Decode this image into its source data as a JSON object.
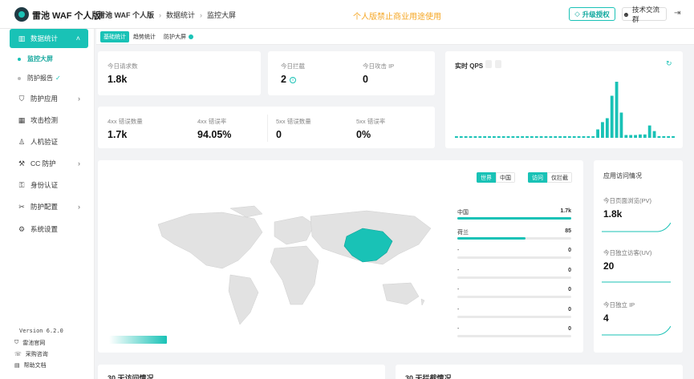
{
  "app": {
    "title": "雷池 WAF 个人版"
  },
  "breadcrumb": {
    "root": "雷池 WAF 个人版",
    "level1": "数据统计",
    "level2": "监控大屏"
  },
  "notice": "个人版禁止商业用途使用",
  "header": {
    "upgrade_label": "升级授权",
    "chat_label": "技术交流群",
    "logout_icon": "logout-icon"
  },
  "sidebar": {
    "items": [
      {
        "label": "数据统计",
        "icon": "chart-icon"
      },
      {
        "label": "防护应用",
        "icon": "shield-icon"
      },
      {
        "label": "攻击检测",
        "icon": "calendar-icon"
      },
      {
        "label": "人机验证",
        "icon": "user-icon"
      },
      {
        "label": "CC 防护",
        "icon": "wrench-icon"
      },
      {
        "label": "身份认证",
        "icon": "id-icon"
      },
      {
        "label": "防护配置",
        "icon": "tools-icon"
      },
      {
        "label": "系统设置",
        "icon": "gear-icon"
      }
    ],
    "sub_items": [
      {
        "label": "监控大屏"
      },
      {
        "label": "防护报告"
      }
    ],
    "version": "Version 6.2.0",
    "footer_links": [
      {
        "label": "雷池官网"
      },
      {
        "label": "采购咨询"
      },
      {
        "label": "帮助文档"
      }
    ]
  },
  "tabs": [
    {
      "label": "基础统计"
    },
    {
      "label": "趋势统计"
    },
    {
      "label": "防护大屏"
    }
  ],
  "stats_top": [
    {
      "label": "今日请求数",
      "value": "1.8k"
    },
    {
      "label": "今日拦截",
      "value": "2"
    },
    {
      "label": "今日攻击 IP",
      "value": "0"
    }
  ],
  "stats_errors": [
    {
      "label": "4xx 错误数量",
      "value": "1.7k"
    },
    {
      "label": "4xx 错误率",
      "value": "94.05%"
    },
    {
      "label": "5xx 错误数量",
      "value": "0"
    },
    {
      "label": "5xx 错误率",
      "value": "0%"
    }
  ],
  "qps": {
    "title": "实时 QPS",
    "bar_levels": [
      0.02,
      0.02,
      0.02,
      0.02,
      0.02,
      0.02,
      0.02,
      0.02,
      0.02,
      0.02,
      0.02,
      0.02,
      0.02,
      0.02,
      0.02,
      0.02,
      0.02,
      0.02,
      0.02,
      0.02,
      0.02,
      0.02,
      0.02,
      0.02,
      0.02,
      0.02,
      0.02,
      0.02,
      0.02,
      0.02,
      0.15,
      0.28,
      0.35,
      0.75,
      1.0,
      0.45,
      0.05,
      0.05,
      0.05,
      0.06,
      0.06,
      0.22,
      0.12,
      0.03,
      0.03,
      0.03,
      0.03
    ]
  },
  "map": {
    "region_toggle": [
      "世界",
      "中国"
    ],
    "metric_toggle": [
      "访问",
      "仅拦截"
    ],
    "ranking": [
      {
        "name": "中国",
        "value": "1.7k",
        "fraction": 1.0
      },
      {
        "name": "荷兰",
        "value": "85",
        "fraction": 0.6
      },
      {
        "name": "-",
        "value": "0",
        "fraction": 0
      },
      {
        "name": "-",
        "value": "0",
        "fraction": 0
      },
      {
        "name": "-",
        "value": "0",
        "fraction": 0
      },
      {
        "name": "-",
        "value": "0",
        "fraction": 0
      },
      {
        "name": "-",
        "value": "0",
        "fraction": 0
      }
    ]
  },
  "app_access": {
    "title": "应用访问情况",
    "items": [
      {
        "label": "今日页面浏览(PV)",
        "value": "1.8k"
      },
      {
        "label": "今日独立访客(UV)",
        "value": "20"
      },
      {
        "label": "今日独立 IP",
        "value": "4"
      }
    ]
  },
  "bottom": {
    "left_title": "30 天访问情况",
    "right_title": "30 天拦截情况"
  }
}
